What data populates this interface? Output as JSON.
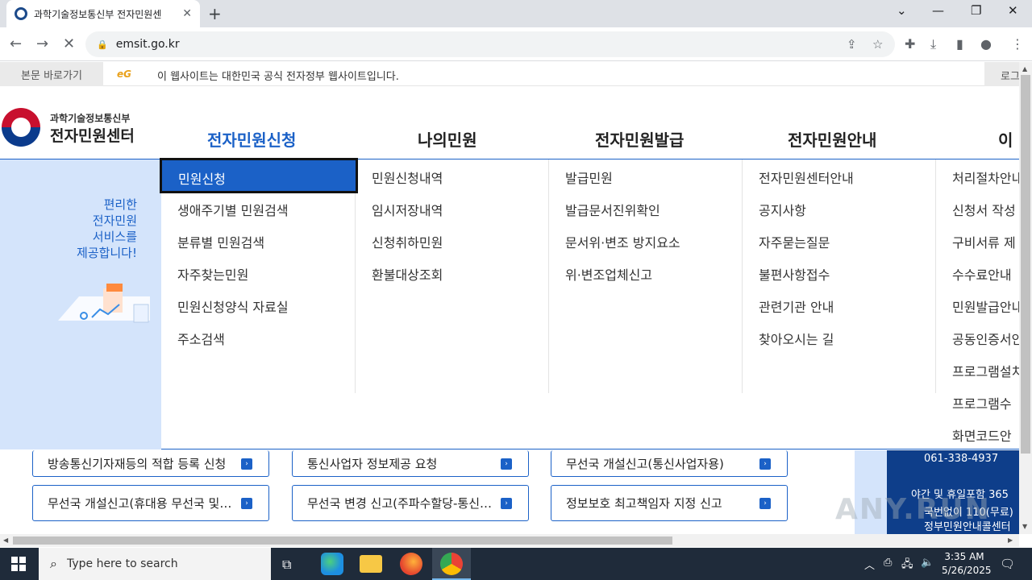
{
  "browser": {
    "tab_title": "과학기술정보통신부 전자민원센",
    "url": "emsit.go.kr"
  },
  "govbar": {
    "skip_link": "본문 바로가기",
    "eg_mark": "eG",
    "notice": "이 웹사이트는 대한민국 공식 전자정부 웹사이트입니다.",
    "login": "로그인"
  },
  "logo": {
    "small": "과학기술정보통신부",
    "big": "전자민원센터"
  },
  "gnb": [
    {
      "label": "전자민원신청",
      "active": true
    },
    {
      "label": "나의민원"
    },
    {
      "label": "전자민원발급"
    },
    {
      "label": "전자민원안내"
    },
    {
      "label": "이"
    }
  ],
  "mega": {
    "tagline": [
      "편리한",
      "전자민원",
      "서비스를",
      "제공합니다!"
    ],
    "columns": [
      [
        "민원신청",
        "생애주기별 민원검색",
        "분류별 민원검색",
        "자주찾는민원",
        "민원신청양식 자료실",
        "주소검색"
      ],
      [
        "민원신청내역",
        "임시저장내역",
        "신청취하민원",
        "환불대상조회"
      ],
      [
        "발급민원",
        "발급문서진위확인",
        "문서위·변조 방지요소",
        "위·변조업체신고"
      ],
      [
        "전자민원센터안내",
        "공지사항",
        "자주묻는질문",
        "불편사항접수",
        "관련기관 안내",
        "찾아오시는 길"
      ],
      [
        "처리절차안내",
        "신청서 작성",
        "구비서류 제",
        "수수료안내",
        "민원발급안내",
        "공동인증서안",
        "프로그램설치",
        "프로그램수",
        "화면코드안"
      ]
    ]
  },
  "quick_links": [
    "방송통신기자재등의 적합 등록 신청",
    "통신사업자 정보제공 요청",
    "무선국 개설신고(통신사업자용)",
    "무선국 개설신고(휴대용 무선국 및…",
    "무선국 변경 신고(주파수할당-통신…",
    "정보보호 최고책임자 지정 신고"
  ],
  "callcenter": {
    "phone": "061-338-4937",
    "night": "야간 및 휴일포함 365",
    "line3": "국번없이 110(무료)",
    "line4": "정부민원안내콜센터"
  },
  "watermark": "ANY.RUN",
  "taskbar": {
    "search_placeholder": "Type here to search",
    "time": "3:35 AM",
    "date": "5/26/2025"
  }
}
